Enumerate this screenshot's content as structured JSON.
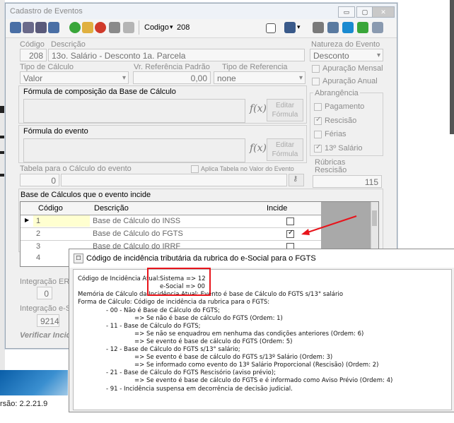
{
  "window": {
    "title": "Cadastro de Eventos",
    "controls": {
      "minimize": "▭",
      "maximize": "▢",
      "close": "✕"
    }
  },
  "toolbar": {
    "codigo_label": "Codigo",
    "codigo_value": "208",
    "icons": [
      "first-icon",
      "prev-icon",
      "next-icon",
      "last-icon",
      "add-icon",
      "edit-icon",
      "cancel-icon",
      "save-icon",
      "undo-icon",
      "checkbox-icon",
      "binoculars-icon",
      "calculator-icon",
      "copy-icon",
      "refresh-icon",
      "person-icon",
      "document-icon"
    ]
  },
  "evento": {
    "codigo_label": "Código",
    "descricao_label": "Descrição",
    "codigo": "208",
    "descricao": "13o. Salário - Desconto 1a. Parcela",
    "tipo_calculo_label": "Tipo de Cálculo",
    "tipo_calculo": "Valor",
    "vr_ref_label": "Vr. Referência Padrão",
    "vr_ref": "0,00",
    "tipo_ref_label": "Tipo de Referencia",
    "tipo_ref": "none",
    "formula_base_label": "Fórmula de composição da Base de Cálculo",
    "formula_evento_label": "Fórmula do evento",
    "fx_label": "f(x)",
    "editar_formula_line1": "Editar",
    "editar_formula_line2": "Fórmula",
    "tabela_label": "Tabela para o Cálculo do evento",
    "tabela_value": "0",
    "aplica_tabela_label": "Aplica Tabela no Valor do Evento"
  },
  "natureza": {
    "label": "Natureza do Evento",
    "value": "Desconto",
    "apuracao_mensal": "Apuração Mensal",
    "apuracao_anual": "Apuração Anual",
    "abrangencia_label": "Abrangência",
    "pagamento": "Pagamento",
    "rescisao": "Rescisão",
    "ferias": "Férias",
    "decimo_terceiro": "13º Salário",
    "rubricas_label_1": "Rúbricas",
    "rubricas_label_2": "Rescisão",
    "rubricas_value": "115"
  },
  "base_calculos": {
    "title": "Base de Cálculos que o evento incide",
    "columns": [
      "Código",
      "Descrição",
      "Incide"
    ],
    "rows": [
      {
        "codigo": "1",
        "descricao": "Base de Cálculo do INSS",
        "incide": false
      },
      {
        "codigo": "2",
        "descricao": "Base de Cálculo do FGTS",
        "incide": true
      },
      {
        "codigo": "3",
        "descricao": "Base de Cálculo do IRRF",
        "incide": false
      },
      {
        "codigo": "4",
        "descricao": "",
        "incide": false
      }
    ]
  },
  "integracao": {
    "label1": "Integração ER",
    "value1": "0",
    "label2": "Integração e-S",
    "value2": "9214",
    "verificar": "Verificar Incid"
  },
  "footer": {
    "versao": "rsão: 2.2.21.9"
  },
  "dialog": {
    "title": "Código de incidência tributária da rubrica do e-Social para o FGTS",
    "lines": [
      "Código de Incidência Atual:",
      "Sistema => 12",
      "e-Social => 00",
      "Memória de Cálculo da Incidência Atual: Evento é base de Cálculo do FGTS s/13° salário",
      "Forma de Cálculo: Código de incidência da rubrica para o FGTS:",
      "- 00 - Não é Base de Cálculo do FGTS;",
      "=> Se não é base de cálculo do FGTS (Ordem: 1)",
      "- 11 - Base de Cálculo do FGTS;",
      "=> Se não se enquadrou em nenhuma das condições anteriores (Ordem: 6)",
      "=> Se evento é base de cálculo do FGTS (Ordem: 5)",
      "- 12 - Base de Cálculo do FGTS s/13° salário;",
      "=> Se evento é base de cálculo do FGTS s/13º Salário (Ordem: 3)",
      "=> Se informado como evento do 13º Salário Proporcional (Rescisão) (Ordem: 2)",
      "- 21 - Base de Cálculo do FGTS Rescisório (aviso prévio);",
      "=> Se evento é base de cálculo do FGTS e é informado como Aviso Prévio (Ordem: 4)",
      "- 91 - Incidência suspensa em decorrência de decisão judicial."
    ]
  },
  "colors": {
    "highlight": "#e8141b",
    "selected_row": "#ffffd0",
    "grid_side": "#a9a9a9"
  }
}
